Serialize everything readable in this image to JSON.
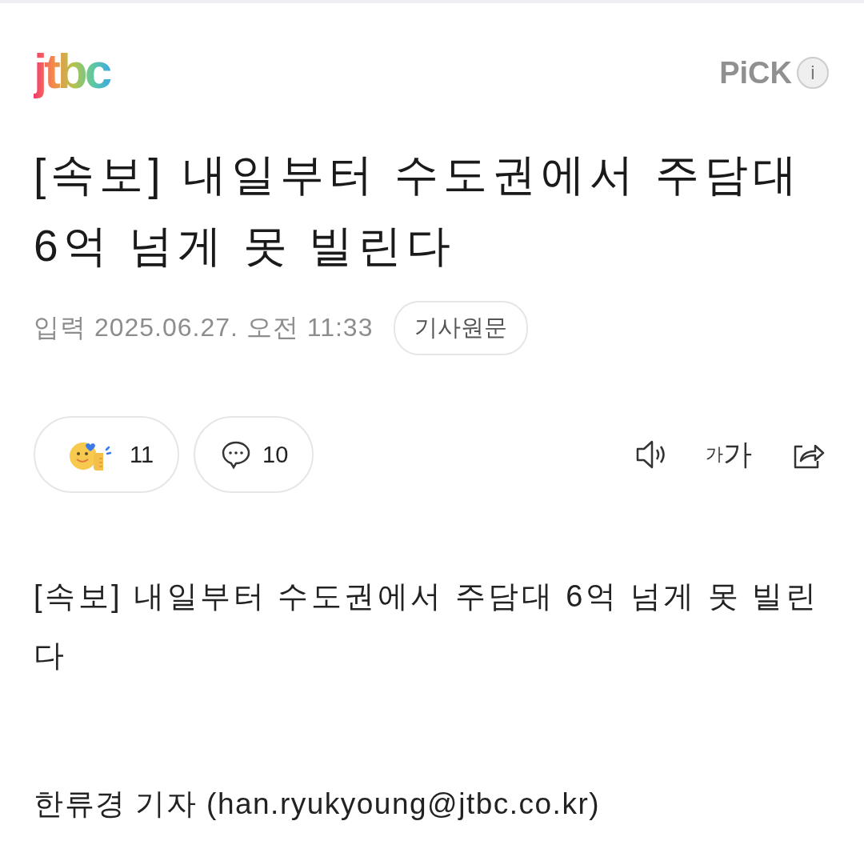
{
  "header": {
    "logo": "jtbc",
    "badge": "PiCK",
    "info": "i"
  },
  "headline": "[속보] 내일부터 수도권에서 주담대 6억 넘게 못 빌린다",
  "meta": {
    "input_label": "입력",
    "datetime": "2025.06.27. 오전 11:33",
    "original_button": "기사원문"
  },
  "reactions": [
    {
      "kind": "emotion",
      "count": "11"
    },
    {
      "kind": "comment",
      "count": "10"
    }
  ],
  "tools": [
    {
      "kind": "audio"
    },
    {
      "kind": "font_size",
      "small": "가",
      "large": "가"
    },
    {
      "kind": "share"
    }
  ],
  "body": "[속보] 내일부터 수도권에서 주담대 6억 넘게 못 빌린다",
  "byline": "한류경 기자 (han.ryukyoung@jtbc.co.kr)"
}
